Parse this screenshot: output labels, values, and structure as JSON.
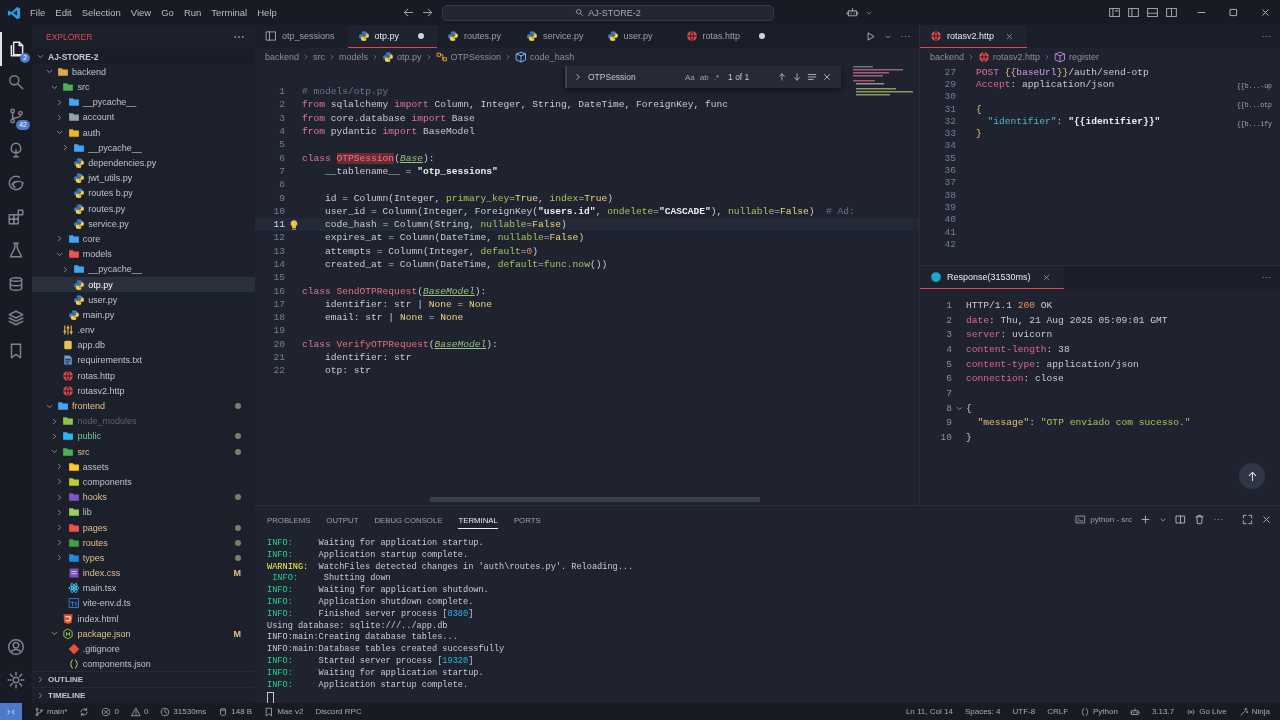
{
  "menu": [
    "File",
    "Edit",
    "Selection",
    "View",
    "Go",
    "Run",
    "Terminal",
    "Help"
  ],
  "title_bar": {
    "search": "AJ-STORE-2"
  },
  "activity_bar": [
    {
      "kind": "files",
      "selected": true,
      "badge": "2"
    },
    {
      "kind": "search",
      "selected": false
    },
    {
      "kind": "branch",
      "selected": false,
      "badge": "42"
    },
    {
      "kind": "tree",
      "selected": false
    },
    {
      "kind": "browser",
      "selected": false
    },
    {
      "kind": "extensions",
      "selected": false
    },
    {
      "kind": "flask",
      "selected": false
    },
    {
      "kind": "database",
      "selected": false
    },
    {
      "kind": "layers",
      "selected": false
    },
    {
      "kind": "bookmark",
      "selected": false
    }
  ],
  "activity_bottom": [
    {
      "kind": "account"
    },
    {
      "kind": "gear"
    }
  ],
  "sidebar": {
    "title": "EXPLORER",
    "root": "AJ-STORE-2",
    "sections": [
      "OUTLINE",
      "TIMELINE"
    ],
    "tree": [
      {
        "name": "backend",
        "kind": "folder",
        "color": "#e0a84a",
        "expanded": true,
        "selected": false,
        "modified": false,
        "untracked": false,
        "ignored": false,
        "dot": false,
        "children": [
          {
            "name": "src",
            "kind": "folder",
            "color": "#4caf50",
            "expanded": true,
            "selected": false,
            "modified": false,
            "untracked": false,
            "ignored": false,
            "dot": false,
            "children": [
              {
                "name": "__pycache__",
                "kind": "folder",
                "color": "#42a5f5",
                "expanded": false,
                "selected": false,
                "modified": false,
                "untracked": false,
                "ignored": false,
                "dot": false
              },
              {
                "name": "account",
                "kind": "folder",
                "color": "#90a4ae",
                "expanded": false,
                "selected": false,
                "modified": false,
                "untracked": false,
                "ignored": false,
                "dot": false
              },
              {
                "name": "auth",
                "kind": "folder",
                "color": "#f0b429",
                "expanded": true,
                "selected": false,
                "modified": false,
                "untracked": false,
                "ignored": false,
                "dot": false,
                "children": [
                  {
                    "name": "__pycache__",
                    "kind": "folder",
                    "color": "#42a5f5",
                    "expanded": false,
                    "selected": false,
                    "modified": false,
                    "untracked": false,
                    "ignored": false,
                    "dot": false
                  },
                  {
                    "name": "dependencies.py",
                    "kind": "python",
                    "selected": false,
                    "modified": false,
                    "untracked": false,
                    "ignored": false,
                    "dot": false
                  },
                  {
                    "name": "jwt_utils.py",
                    "kind": "python",
                    "selected": false,
                    "modified": false,
                    "untracked": false,
                    "ignored": false,
                    "dot": false
                  },
                  {
                    "name": "routes b.py",
                    "kind": "python",
                    "selected": false,
                    "modified": false,
                    "untracked": false,
                    "ignored": false,
                    "dot": false
                  },
                  {
                    "name": "routes.py",
                    "kind": "python",
                    "selected": false,
                    "modified": false,
                    "untracked": false,
                    "ignored": false,
                    "dot": false
                  },
                  {
                    "name": "service.py",
                    "kind": "python",
                    "selected": false,
                    "modified": false,
                    "untracked": false,
                    "ignored": false,
                    "dot": false
                  }
                ]
              },
              {
                "name": "core",
                "kind": "folder",
                "color": "#42a5f5",
                "expanded": false,
                "selected": false,
                "modified": false,
                "untracked": false,
                "ignored": false,
                "dot": false
              },
              {
                "name": "models",
                "kind": "folder",
                "color": "#ef5350",
                "expanded": true,
                "selected": false,
                "modified": false,
                "untracked": false,
                "ignored": false,
                "dot": false,
                "children": [
                  {
                    "name": "__pycache__",
                    "kind": "folder",
                    "color": "#42a5f5",
                    "expanded": false,
                    "selected": false,
                    "modified": false,
                    "untracked": false,
                    "ignored": false,
                    "dot": false
                  },
                  {
                    "name": "otp.py",
                    "kind": "python",
                    "selected": true,
                    "modified": false,
                    "untracked": false,
                    "ignored": false,
                    "dot": false
                  },
                  {
                    "name": "user.py",
                    "kind": "python",
                    "selected": false,
                    "modified": false,
                    "untracked": false,
                    "ignored": false,
                    "dot": false
                  }
                ]
              },
              {
                "name": "main.py",
                "kind": "python",
                "selected": false,
                "modified": false,
                "untracked": false,
                "ignored": false,
                "dot": false
              }
            ]
          },
          {
            "name": ".env",
            "kind": "env",
            "selected": false,
            "modified": false,
            "untracked": false,
            "ignored": false,
            "dot": false
          },
          {
            "name": "app.db",
            "kind": "db",
            "selected": false,
            "modified": false,
            "untracked": false,
            "ignored": false,
            "dot": false
          },
          {
            "name": "requirements.txt",
            "kind": "txt",
            "selected": false,
            "modified": false,
            "untracked": false,
            "ignored": false,
            "dot": false
          },
          {
            "name": "rotas.http",
            "kind": "http",
            "selected": false,
            "modified": false,
            "untracked": false,
            "ignored": false,
            "dot": false
          },
          {
            "name": "rotasv2.http",
            "kind": "http",
            "selected": false,
            "modified": false,
            "untracked": false,
            "ignored": false,
            "dot": false
          }
        ]
      },
      {
        "name": "frontend",
        "kind": "folder",
        "color": "#42a5f5",
        "expanded": true,
        "selected": false,
        "modified": true,
        "untracked": false,
        "ignored": false,
        "dot": true,
        "children": [
          {
            "name": "node_modules",
            "kind": "folder",
            "color": "#8bc34a",
            "expanded": false,
            "selected": false,
            "modified": false,
            "untracked": false,
            "ignored": true,
            "dot": false
          },
          {
            "name": "public",
            "kind": "folder",
            "color": "#29b6f6",
            "expanded": false,
            "selected": false,
            "modified": false,
            "untracked": true,
            "ignored": false,
            "dot": true
          },
          {
            "name": "src",
            "kind": "folder",
            "color": "#4caf50",
            "expanded": true,
            "selected": false,
            "modified": true,
            "untracked": false,
            "ignored": false,
            "dot": true,
            "children": [
              {
                "name": "assets",
                "kind": "folder",
                "color": "#ffca28",
                "expanded": false,
                "selected": false,
                "modified": false,
                "untracked": false,
                "ignored": false,
                "dot": false
              },
              {
                "name": "components",
                "kind": "folder",
                "color": "#c0ca33",
                "expanded": false,
                "selected": false,
                "modified": false,
                "untracked": false,
                "ignored": false,
                "dot": false
              },
              {
                "name": "hooks",
                "kind": "folder",
                "color": "#7e57c2",
                "expanded": false,
                "selected": false,
                "modified": true,
                "untracked": false,
                "ignored": false,
                "dot": true
              },
              {
                "name": "lib",
                "kind": "folder",
                "color": "#9ccc65",
                "expanded": false,
                "selected": false,
                "modified": false,
                "untracked": false,
                "ignored": false,
                "dot": false
              },
              {
                "name": "pages",
                "kind": "folder",
                "color": "#ef5350",
                "expanded": false,
                "selected": false,
                "modified": true,
                "untracked": false,
                "ignored": false,
                "dot": true
              },
              {
                "name": "routes",
                "kind": "folder",
                "color": "#43a047",
                "expanded": false,
                "selected": false,
                "modified": true,
                "untracked": false,
                "ignored": false,
                "dot": true
              },
              {
                "name": "types",
                "kind": "folder",
                "color": "#1e88e5",
                "expanded": false,
                "selected": false,
                "modified": true,
                "untracked": false,
                "ignored": false,
                "dot": true
              },
              {
                "name": "index.css",
                "kind": "css",
                "selected": false,
                "modified": true,
                "untracked": false,
                "ignored": false,
                "dot": false,
                "badge": "M"
              },
              {
                "name": "main.tsx",
                "kind": "react",
                "selected": false,
                "modified": false,
                "untracked": false,
                "ignored": false,
                "dot": false
              },
              {
                "name": "vite-env.d.ts",
                "kind": "ts",
                "selected": false,
                "modified": false,
                "untracked": false,
                "ignored": false,
                "dot": false
              }
            ]
          },
          {
            "name": "index.html",
            "kind": "html",
            "selected": false,
            "modified": false,
            "untracked": false,
            "ignored": false,
            "dot": false
          },
          {
            "name": "package.json",
            "kind": "json",
            "expanded": true,
            "selected": false,
            "modified": true,
            "untracked": false,
            "ignored": false,
            "dot": false,
            "badge": "M",
            "children": [
              {
                "name": ".gitignore",
                "kind": "git",
                "selected": false,
                "modified": false,
                "untracked": false,
                "ignored": false,
                "dot": false
              },
              {
                "name": "components.json",
                "kind": "braces",
                "selected": false,
                "modified": false,
                "untracked": false,
                "ignored": false,
                "dot": false
              }
            ]
          }
        ]
      }
    ]
  },
  "editor": {
    "tabs": [
      {
        "label": "otp_sessions",
        "kind": "table",
        "selected": false,
        "dirty": false
      },
      {
        "label": "otp.py",
        "kind": "python",
        "selected": true,
        "dirty": true
      },
      {
        "label": "routes.py",
        "kind": "python",
        "selected": false,
        "dirty": false
      },
      {
        "label": "service.py",
        "kind": "python",
        "selected": false,
        "dirty": false
      },
      {
        "label": "user.py",
        "kind": "python",
        "selected": false,
        "dirty": false
      },
      {
        "label": "rotas.http",
        "kind": "http",
        "selected": false,
        "dirty": true
      }
    ],
    "breadcrumbs": [
      {
        "label": "backend"
      },
      {
        "label": "src"
      },
      {
        "label": "models"
      },
      {
        "label": "otp.py",
        "kind": "python"
      },
      {
        "label": "OTPSession",
        "kind": "class"
      },
      {
        "label": "code_hash",
        "kind": "field"
      }
    ],
    "find": {
      "query": "OTPSession",
      "options": [
        "Aa",
        "ab",
        ".*"
      ],
      "count": "1 of 1"
    },
    "lines": [
      {
        "n": "1",
        "current": false,
        "code": [
          {
            "kind": "comment",
            "text": "# models/otp.py"
          }
        ]
      },
      {
        "n": "2",
        "current": false,
        "code": [
          {
            "kind": "keyword",
            "text": "from"
          },
          {
            "kind": "plain",
            "text": " sqlalchemy "
          },
          {
            "kind": "keyword",
            "text": "import"
          },
          {
            "kind": "plain",
            "text": " Column, Integer, String, DateTime, ForeignKey, func"
          }
        ]
      },
      {
        "n": "3",
        "current": false,
        "code": [
          {
            "kind": "keyword",
            "text": "from"
          },
          {
            "kind": "plain",
            "text": " core.database "
          },
          {
            "kind": "keyword",
            "text": "import"
          },
          {
            "kind": "plain",
            "text": " Base"
          }
        ]
      },
      {
        "n": "4",
        "current": false,
        "code": [
          {
            "kind": "keyword",
            "text": "from"
          },
          {
            "kind": "plain",
            "text": " pydantic "
          },
          {
            "kind": "keyword",
            "text": "import"
          },
          {
            "kind": "plain",
            "text": " BaseModel"
          }
        ]
      },
      {
        "n": "5",
        "current": false
      },
      {
        "n": "6",
        "current": false,
        "code": [
          {
            "kind": "keyword",
            "text": "class "
          },
          {
            "kind": "match",
            "text": "OTPSession"
          },
          {
            "kind": "plain",
            "text": "("
          },
          {
            "kind": "base",
            "text": "Base"
          },
          {
            "kind": "plain",
            "text": "):"
          }
        ]
      },
      {
        "n": "7",
        "current": false,
        "code": [
          {
            "kind": "plain",
            "text": "    __tablename__ = "
          },
          {
            "kind": "string",
            "text": "\"otp_sessions\""
          }
        ]
      },
      {
        "n": "8",
        "current": false
      },
      {
        "n": "9",
        "current": false,
        "code": [
          {
            "kind": "plain",
            "text": "    id = Column(Integer, "
          },
          {
            "kind": "param",
            "text": "primary_key"
          },
          {
            "kind": "plain",
            "text": "="
          },
          {
            "kind": "constant",
            "text": "True"
          },
          {
            "kind": "plain",
            "text": ", "
          },
          {
            "kind": "param",
            "text": "index"
          },
          {
            "kind": "plain",
            "text": "="
          },
          {
            "kind": "constant",
            "text": "True"
          },
          {
            "kind": "plain",
            "text": ")"
          }
        ]
      },
      {
        "n": "10",
        "current": false,
        "code": [
          {
            "kind": "plain",
            "text": "    user_id = Column(Integer, ForeignKey("
          },
          {
            "kind": "string",
            "text": "\"users.id\""
          },
          {
            "kind": "plain",
            "text": ", "
          },
          {
            "kind": "param",
            "text": "ondelete"
          },
          {
            "kind": "plain",
            "text": "="
          },
          {
            "kind": "string",
            "text": "\"CASCADE\""
          },
          {
            "kind": "plain",
            "text": "), "
          },
          {
            "kind": "param",
            "text": "nullable"
          },
          {
            "kind": "plain",
            "text": "="
          },
          {
            "kind": "constant",
            "text": "False"
          },
          {
            "kind": "plain",
            "text": ")  "
          },
          {
            "kind": "comment",
            "text": "# Ad:"
          }
        ]
      },
      {
        "n": "11",
        "current": true,
        "code": [
          {
            "kind": "plain",
            "text": "    code_hash = Column(String, "
          },
          {
            "kind": "param",
            "text": "nullable"
          },
          {
            "kind": "plain",
            "text": "="
          },
          {
            "kind": "constant",
            "text": "False"
          },
          {
            "kind": "plain",
            "text": ")"
          }
        ]
      },
      {
        "n": "12",
        "current": false,
        "code": [
          {
            "kind": "plain",
            "text": "    expires_at = Column(DateTime, "
          },
          {
            "kind": "param",
            "text": "nullable"
          },
          {
            "kind": "plain",
            "text": "="
          },
          {
            "kind": "constant",
            "text": "False"
          },
          {
            "kind": "plain",
            "text": ")"
          }
        ]
      },
      {
        "n": "13",
        "current": false,
        "code": [
          {
            "kind": "plain",
            "text": "    attempts = Column(Integer, "
          },
          {
            "kind": "param",
            "text": "default"
          },
          {
            "kind": "plain",
            "text": "="
          },
          {
            "kind": "number",
            "text": "0"
          },
          {
            "kind": "plain",
            "text": ")"
          }
        ]
      },
      {
        "n": "14",
        "current": false,
        "code": [
          {
            "kind": "plain",
            "text": "    created_at = Column(DateTime, "
          },
          {
            "kind": "param",
            "text": "default"
          },
          {
            "kind": "plain",
            "text": "="
          },
          {
            "kind": "param",
            "text": "func.now"
          },
          {
            "kind": "plain",
            "text": "())"
          }
        ]
      },
      {
        "n": "15",
        "current": false
      },
      {
        "n": "16",
        "current": false,
        "code": [
          {
            "kind": "keyword",
            "text": "class "
          },
          {
            "kind": "classname",
            "text": "SendOTPRequest"
          },
          {
            "kind": "plain",
            "text": "("
          },
          {
            "kind": "base",
            "text": "BaseModel"
          },
          {
            "kind": "plain",
            "text": "):"
          }
        ]
      },
      {
        "n": "17",
        "current": false,
        "code": [
          {
            "kind": "plain",
            "text": "    identifier: str | "
          },
          {
            "kind": "constant",
            "text": "None"
          },
          {
            "kind": "plain",
            "text": " = "
          },
          {
            "kind": "constant",
            "text": "None"
          }
        ]
      },
      {
        "n": "18",
        "current": false,
        "code": [
          {
            "kind": "plain",
            "text": "    email: str | "
          },
          {
            "kind": "constant",
            "text": "None"
          },
          {
            "kind": "plain",
            "text": " = "
          },
          {
            "kind": "constant",
            "text": "None"
          }
        ]
      },
      {
        "n": "19",
        "current": false
      },
      {
        "n": "20",
        "current": false,
        "code": [
          {
            "kind": "keyword",
            "text": "class "
          },
          {
            "kind": "classname",
            "text": "VerifyOTPRequest"
          },
          {
            "kind": "plain",
            "text": "("
          },
          {
            "kind": "base",
            "text": "BaseModel"
          },
          {
            "kind": "plain",
            "text": "):"
          }
        ]
      },
      {
        "n": "21",
        "current": false,
        "code": [
          {
            "kind": "plain",
            "text": "    identifier: str"
          }
        ]
      },
      {
        "n": "22",
        "current": false,
        "code": [
          {
            "kind": "plain",
            "text": "    otp: str"
          }
        ]
      }
    ]
  },
  "right_editor": {
    "tab": "rotasv2.http",
    "breadcrumbs": [
      {
        "label": "backend"
      },
      {
        "label": "rotasv2.http",
        "kind": "http"
      },
      {
        "label": "register",
        "kind": "cube"
      }
    ],
    "minimap_labels": [
      "{{b...-up",
      "{{b...otp",
      "{{b...ify"
    ],
    "lines": [
      {
        "n": "27",
        "code": [
          {
            "kind": "keyword",
            "text": "POST "
          },
          {
            "kind": "brace",
            "text": "{{"
          },
          {
            "kind": "var",
            "text": "baseUrl"
          },
          {
            "kind": "brace",
            "text": "}}"
          },
          {
            "kind": "plain",
            "text": "/auth/send-otp"
          }
        ]
      },
      {
        "n": "29",
        "code": [
          {
            "kind": "header",
            "text": "Accept"
          },
          {
            "kind": "plain",
            "text": ": application/json"
          }
        ]
      },
      {
        "n": "30"
      },
      {
        "n": "31",
        "code": [
          {
            "kind": "brace",
            "text": "{"
          }
        ]
      },
      {
        "n": "32",
        "code": [
          {
            "kind": "key",
            "text": "  \"identifier\""
          },
          {
            "kind": "plain",
            "text": ": "
          },
          {
            "kind": "string",
            "text": "\"{{identifier}}\""
          }
        ]
      },
      {
        "n": "33",
        "code": [
          {
            "kind": "brace",
            "text": "}"
          }
        ]
      },
      {
        "n": "34"
      },
      {
        "n": "35"
      },
      {
        "n": "36"
      },
      {
        "n": "37"
      },
      {
        "n": "38"
      },
      {
        "n": "39"
      },
      {
        "n": "40"
      },
      {
        "n": "41"
      },
      {
        "n": "42"
      }
    ]
  },
  "response": {
    "tab": "Response(31530ms)",
    "lines": [
      {
        "n": "1",
        "code": [
          {
            "kind": "plain",
            "text": "HTTP/1.1 "
          },
          {
            "kind": "number",
            "text": "200"
          },
          {
            "kind": "plain",
            "text": " OK"
          }
        ]
      },
      {
        "n": "2",
        "code": [
          {
            "kind": "header",
            "text": "date"
          },
          {
            "kind": "plain",
            "text": ": Thu, 21 Aug 2025 05:09:01 GMT"
          }
        ]
      },
      {
        "n": "3",
        "code": [
          {
            "kind": "header",
            "text": "server"
          },
          {
            "kind": "plain",
            "text": ": uvicorn"
          }
        ]
      },
      {
        "n": "4",
        "code": [
          {
            "kind": "header",
            "text": "content-length"
          },
          {
            "kind": "plain",
            "text": ": 38"
          }
        ]
      },
      {
        "n": "5",
        "code": [
          {
            "kind": "header",
            "text": "content-type"
          },
          {
            "kind": "plain",
            "text": ": application/json"
          }
        ]
      },
      {
        "n": "6",
        "code": [
          {
            "kind": "header",
            "text": "connection"
          },
          {
            "kind": "plain",
            "text": ": close"
          }
        ]
      },
      {
        "n": "7"
      },
      {
        "n": "8",
        "folded": false,
        "code": [
          {
            "kind": "plain",
            "text": "{"
          }
        ]
      },
      {
        "n": "9",
        "code": [
          {
            "kind": "jsonkey",
            "text": "  \"message\""
          },
          {
            "kind": "plain",
            "text": ": "
          },
          {
            "kind": "jsonstring",
            "text": "\"OTP enviado com sucesso.\""
          }
        ]
      },
      {
        "n": "10",
        "code": [
          {
            "kind": "plain",
            "text": "}"
          }
        ]
      }
    ]
  },
  "panel": {
    "tabs": [
      {
        "label": "PROBLEMS",
        "selected": false
      },
      {
        "label": "OUTPUT",
        "selected": false
      },
      {
        "label": "DEBUG CONSOLE",
        "selected": false
      },
      {
        "label": "TERMINAL",
        "selected": true
      },
      {
        "label": "PORTS",
        "selected": false
      }
    ],
    "terminal_profile": "python - src",
    "lines": [
      [
        {
          "kind": "info",
          "text": "INFO:"
        },
        {
          "kind": "plain",
          "text": "     Waiting for application startup."
        }
      ],
      [
        {
          "kind": "info",
          "text": "INFO:"
        },
        {
          "kind": "plain",
          "text": "     Application startup complete."
        }
      ],
      [
        {
          "kind": "warn",
          "text": "WARNING:"
        },
        {
          "kind": "plain",
          "text": "  WatchFiles detected changes in 'auth\\routes.py'. Reloading..."
        }
      ],
      [
        {
          "kind": "info",
          "text": " INFO:"
        },
        {
          "kind": "plain",
          "text": "     Shutting down"
        }
      ],
      [
        {
          "kind": "info",
          "text": "INFO:"
        },
        {
          "kind": "plain",
          "text": "     Waiting for application shutdown."
        }
      ],
      [
        {
          "kind": "info",
          "text": "INFO:"
        },
        {
          "kind": "plain",
          "text": "     Application shutdown complete."
        }
      ],
      [
        {
          "kind": "info",
          "text": "INFO:"
        },
        {
          "kind": "plain",
          "text": "     Finished server process ["
        },
        {
          "kind": "pid",
          "text": "8380"
        },
        {
          "kind": "plain",
          "text": "]"
        }
      ],
      [
        {
          "kind": "plain",
          "text": "Using database: sqlite:///../app.db"
        }
      ],
      [
        {
          "kind": "plain",
          "text": "INFO:main:Creating database tables..."
        }
      ],
      [
        {
          "kind": "plain",
          "text": "INFO:main:Database tables created successfully"
        }
      ],
      [
        {
          "kind": "info",
          "text": "INFO:"
        },
        {
          "kind": "plain",
          "text": "     Started server process ["
        },
        {
          "kind": "pid",
          "text": "19320"
        },
        {
          "kind": "plain",
          "text": "]"
        }
      ],
      [
        {
          "kind": "info",
          "text": "INFO:"
        },
        {
          "kind": "plain",
          "text": "     Waiting for application startup."
        }
      ],
      [
        {
          "kind": "info",
          "text": "INFO:"
        },
        {
          "kind": "plain",
          "text": "     Application startup complete."
        }
      ]
    ]
  },
  "status_bar": {
    "left": [
      {
        "kind": "remote"
      },
      {
        "kind": "branch",
        "text": "main*"
      },
      {
        "kind": "sync"
      },
      {
        "kind": "error",
        "text": "0"
      },
      {
        "kind": "warning",
        "text": "0"
      },
      {
        "kind": "clock",
        "text": "31530ms"
      },
      {
        "kind": "db",
        "text": "148 B"
      },
      {
        "kind": "note",
        "text": "Mae v2"
      },
      {
        "kind": "plain",
        "text": "Discord RPC"
      }
    ],
    "right": [
      {
        "kind": "plain",
        "text": "Ln 11, Col 14"
      },
      {
        "kind": "plain",
        "text": "Spaces: 4"
      },
      {
        "kind": "plain",
        "text": "UTF-8"
      },
      {
        "kind": "plain",
        "text": "CRLF"
      },
      {
        "kind": "braces",
        "text": "Python"
      },
      {
        "kind": "robot"
      },
      {
        "kind": "plain",
        "text": "3.13.7"
      },
      {
        "kind": "broadcast",
        "text": "Go Live"
      },
      {
        "kind": "wand",
        "text": "Ninja"
      }
    ]
  }
}
